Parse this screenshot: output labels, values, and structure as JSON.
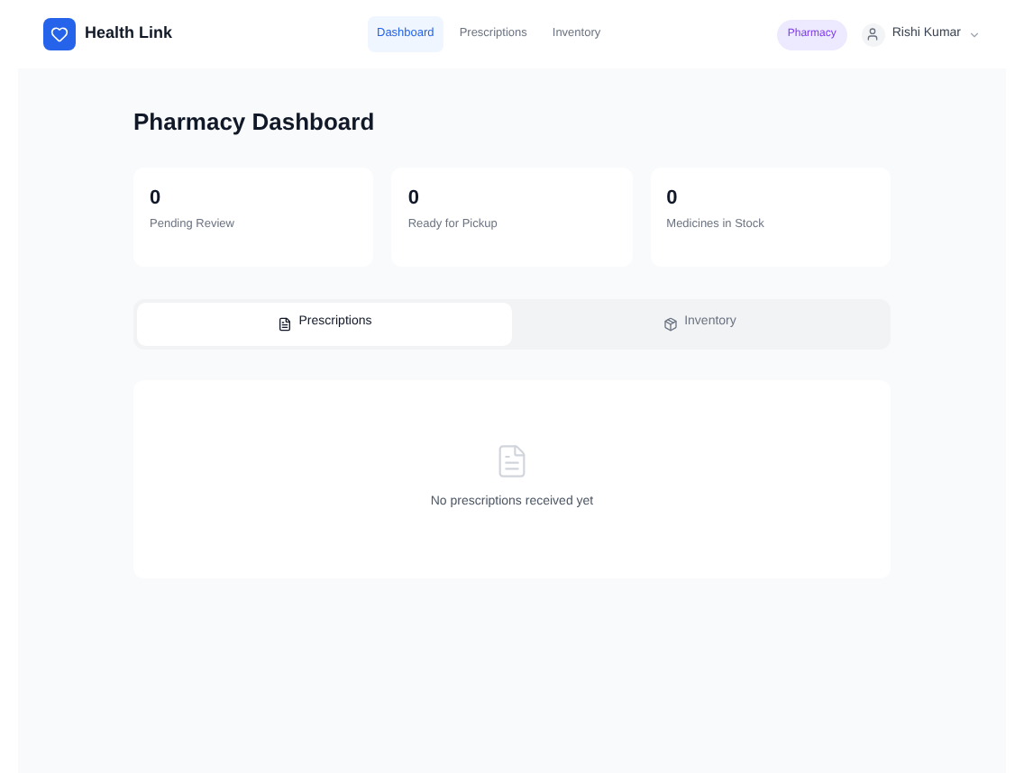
{
  "brand": "Health Link",
  "nav": [
    {
      "label": "Dashboard",
      "selected": true
    },
    {
      "label": "Prescriptions",
      "selected": false
    },
    {
      "label": "Inventory",
      "selected": false
    }
  ],
  "role_badge": "Pharmacy",
  "user": {
    "name": "Rishi Kumar"
  },
  "page_title": "Pharmacy Dashboard",
  "stats": [
    {
      "value": "0",
      "label": "Pending Review"
    },
    {
      "value": "0",
      "label": "Ready for Pickup"
    },
    {
      "value": "0",
      "label": "Medicines in Stock"
    }
  ],
  "tabs": [
    {
      "label": "Prescriptions",
      "kind": "prescriptions",
      "selected": true
    },
    {
      "label": "Inventory",
      "kind": "inventory",
      "selected": false
    }
  ],
  "empty_state": {
    "message": "No prescriptions received yet"
  }
}
